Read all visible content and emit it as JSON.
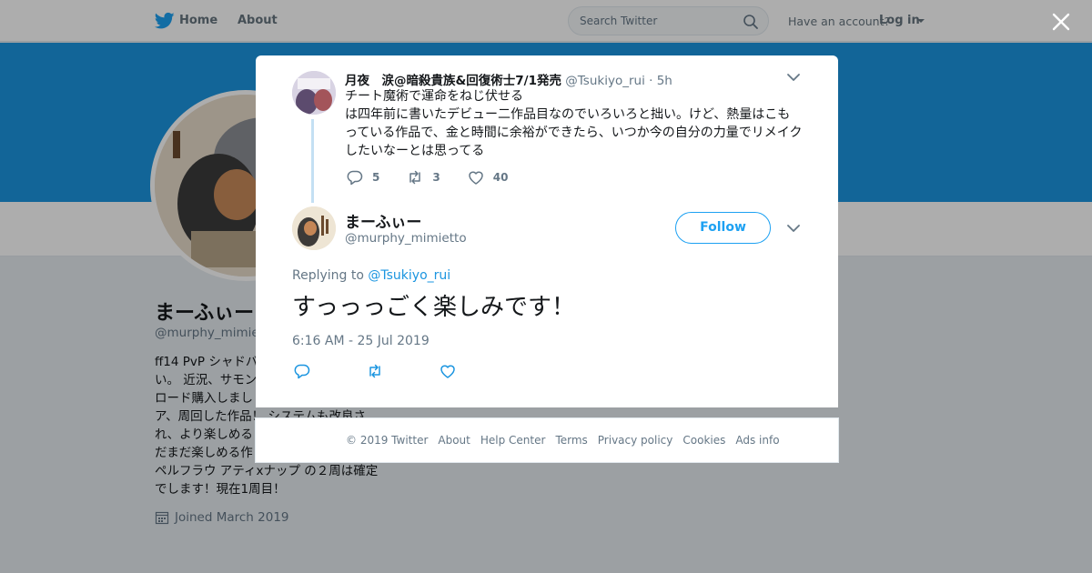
{
  "nav": {
    "home": "Home",
    "about": "About",
    "search_placeholder": "Search Twitter",
    "account_question": "Have an account?",
    "login": "Log in"
  },
  "profile": {
    "name": "まーふぃー",
    "handle": "@murphy_mimietto",
    "bio_lines": [
      "ff14 PvP シャドバ",
      "い。 近況、サモン",
      "ロード購入しまし",
      "ア、周回した作品！ システムも改良さ",
      "れ、より楽しめる",
      "だまだ楽しめる作",
      "ペルフラウ アティxナップ の２周は確定",
      "でします！現在1周目！"
    ],
    "joined": "Joined March 2019"
  },
  "context_tweet": {
    "name": "月夜　涙@暗殺貴族&回復術士7/1発売",
    "handle": "@Tsukiyo_rui",
    "time": "· 5h",
    "text_lines": [
      "チート魔術で運命をねじ伏せる",
      "は四年前に書いたデビュー二作品目なのでいろいろと拙い。けど、熱量はこも",
      "っている作品で、金と時間に余裕ができたら、いつか今の自分の力量でリメイク",
      "したいなーとは思ってる"
    ],
    "replies": "5",
    "retweets": "3",
    "likes": "40"
  },
  "main_tweet": {
    "name": "まーふぃー",
    "handle": "@murphy_mimietto",
    "follow_label": "Follow",
    "replying_to_prefix": "Replying to",
    "replying_to_handle": "@Tsukiyo_rui",
    "text": "すっっっごく楽しみです！",
    "timestamp": "6:16 AM - 25 Jul 2019"
  },
  "footer": {
    "links": [
      "© 2019 Twitter",
      "About",
      "Help Center",
      "Terms",
      "Privacy policy",
      "Cookies",
      "Ads info"
    ]
  },
  "colors": {
    "brand_blue": "#1da1f2",
    "banner_blue": "#1b95e0",
    "muted_text": "#657786",
    "thread_line": "#c4e0f3"
  },
  "icons": {
    "logo": "twitter-bird-icon",
    "search": "search-icon",
    "close": "close-icon",
    "reply": "reply-icon",
    "retweet": "retweet-icon",
    "like": "heart-icon",
    "menu": "chevron-down-icon",
    "calendar": "calendar-icon"
  }
}
